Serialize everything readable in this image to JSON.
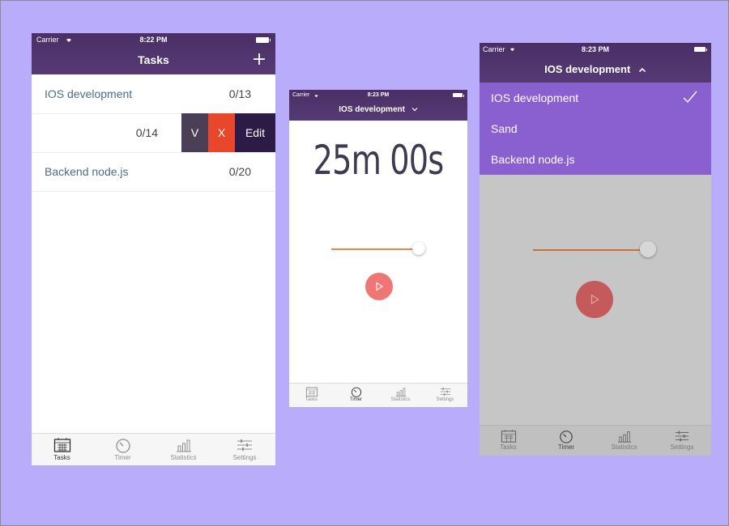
{
  "colors": {
    "background": "#b9acfb",
    "navbar": "#4e3369",
    "dropdown": "#8a5fd0",
    "delete": "#e9472c",
    "accept": "#4b3f57",
    "play": "#f07575",
    "slider": "#e8874b"
  },
  "screen1": {
    "status": {
      "carrier": "Carrier",
      "time": "8:22 PM"
    },
    "title": "Tasks",
    "add_icon": "plus-icon",
    "tasks": [
      {
        "name": "IOS development",
        "count": "0/13"
      },
      {
        "name": "",
        "count": "0/14"
      },
      {
        "name": "Backend node.js",
        "count": "0/20"
      }
    ],
    "swipe_actions": {
      "accept": "V",
      "delete": "X",
      "edit": "Edit"
    },
    "tabs": [
      {
        "label": "Tasks",
        "icon": "calendar-icon",
        "active": true
      },
      {
        "label": "Timer",
        "icon": "stopwatch-icon",
        "active": false
      },
      {
        "label": "Statistics",
        "icon": "bar-chart-icon",
        "active": false
      },
      {
        "label": "Settings",
        "icon": "sliders-icon",
        "active": false
      }
    ]
  },
  "screen2": {
    "status": {
      "carrier": "Carrier",
      "time": "8:23 PM"
    },
    "title": "IOS development",
    "timer": "25m 00s",
    "slider_value": 1.0,
    "tabs": [
      {
        "label": "Tasks",
        "icon": "calendar-icon"
      },
      {
        "label": "Timer",
        "icon": "stopwatch-icon",
        "active": true
      },
      {
        "label": "Statistics",
        "icon": "bar-chart-icon"
      },
      {
        "label": "Settings",
        "icon": "sliders-icon"
      }
    ]
  },
  "screen3": {
    "status": {
      "carrier": "Carrier",
      "time": "8:23 PM"
    },
    "title": "IOS development",
    "dropdown_items": [
      {
        "label": "IOS development",
        "selected": true
      },
      {
        "label": "Sand",
        "selected": false
      },
      {
        "label": "Backend node.js",
        "selected": false
      }
    ],
    "slider_value": 1.0,
    "tabs": [
      {
        "label": "Tasks",
        "icon": "calendar-icon"
      },
      {
        "label": "Timer",
        "icon": "stopwatch-icon",
        "active": true
      },
      {
        "label": "Statistics",
        "icon": "bar-chart-icon"
      },
      {
        "label": "Settings",
        "icon": "sliders-icon"
      }
    ]
  }
}
